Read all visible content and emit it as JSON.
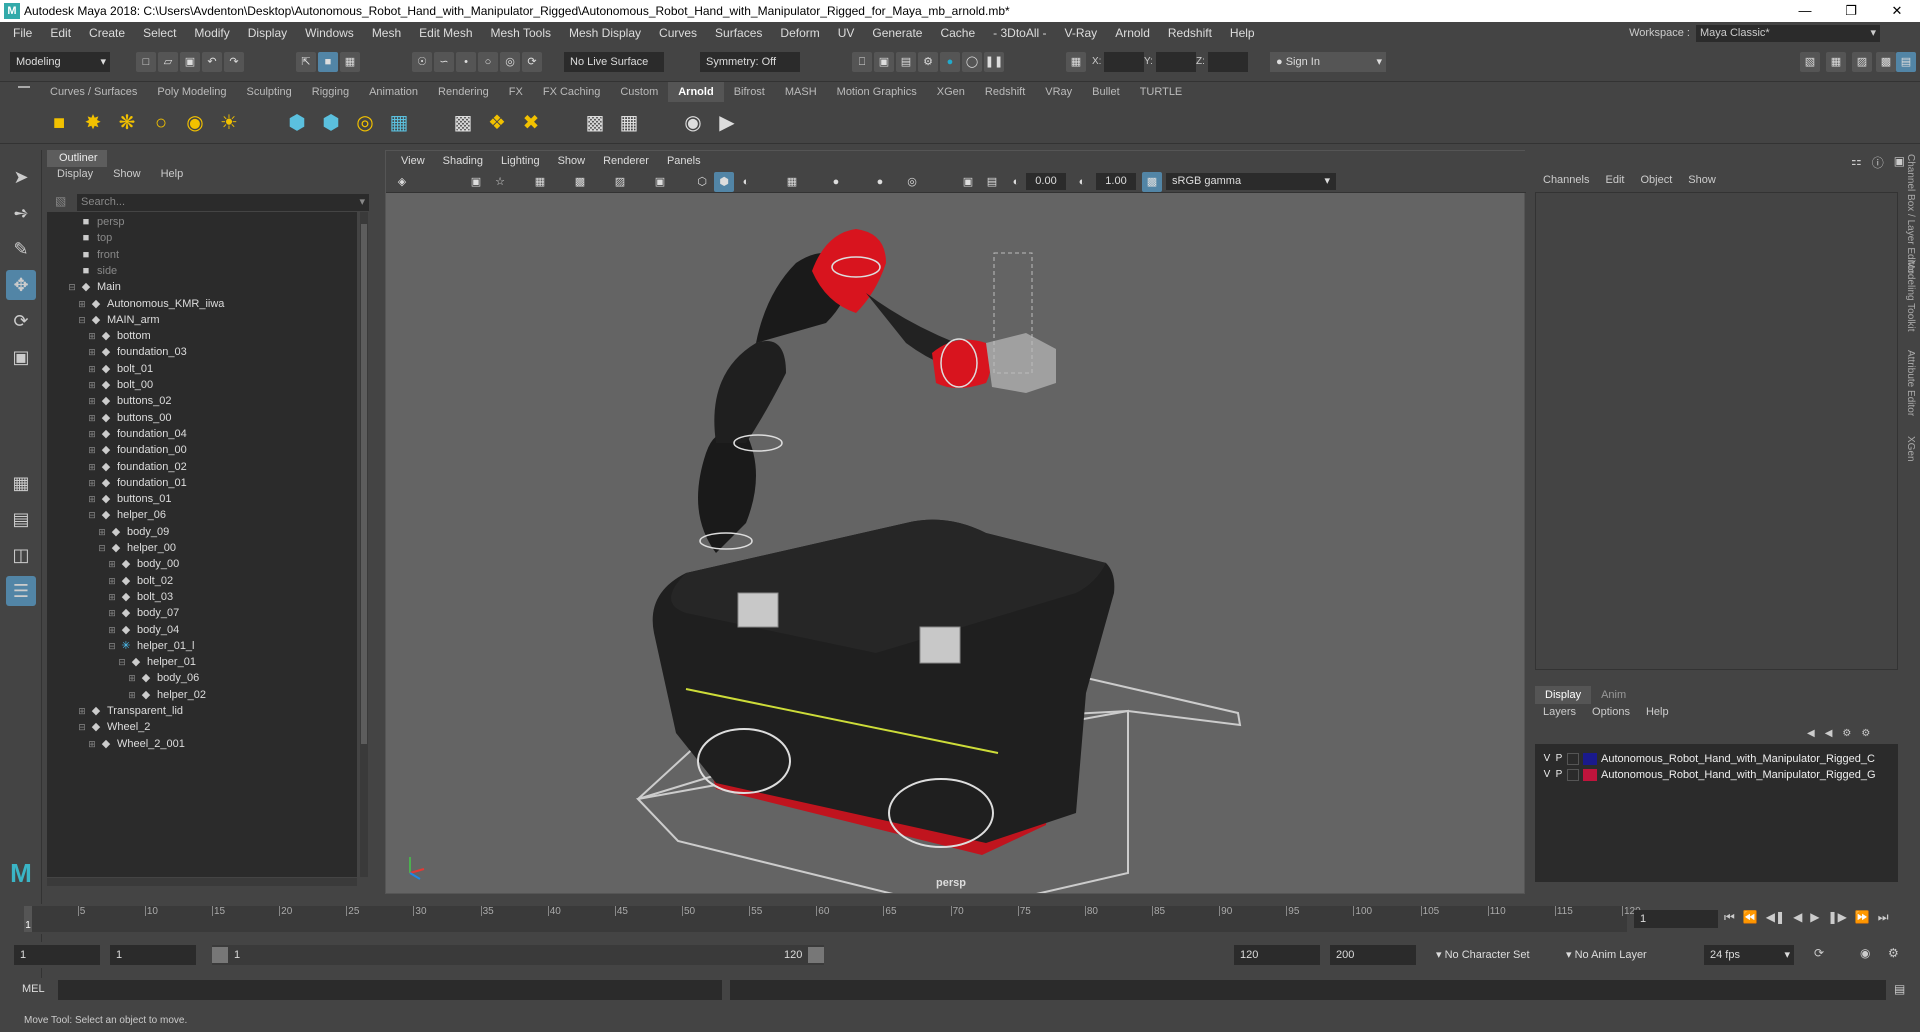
{
  "window": {
    "title": "Autodesk Maya 2018: C:\\Users\\Avdenton\\Desktop\\Autonomous_Robot_Hand_with_Manipulator_Rigged\\Autonomous_Robot_Hand_with_Manipulator_Rigged_for_Maya_mb_arnold.mb*",
    "icon": "M"
  },
  "menubar": [
    "File",
    "Edit",
    "Create",
    "Select",
    "Modify",
    "Display",
    "Windows",
    "Mesh",
    "Edit Mesh",
    "Mesh Tools",
    "Mesh Display",
    "Curves",
    "Surfaces",
    "Deform",
    "UV",
    "Generate",
    "Cache",
    "- 3DtoAll -",
    "V-Ray",
    "Arnold",
    "Redshift",
    "Help"
  ],
  "workspace": {
    "label": "Workspace :",
    "value": "Maya Classic*"
  },
  "statusline": {
    "mode": "Modeling",
    "live_surface": "No Live Surface",
    "symmetry": "Symmetry: Off",
    "x_label": "X:",
    "y_label": "Y:",
    "z_label": "Z:",
    "sign_in": "Sign In"
  },
  "shelf_tabs": [
    "Curves / Surfaces",
    "Poly Modeling",
    "Sculpting",
    "Rigging",
    "Animation",
    "Rendering",
    "FX",
    "FX Caching",
    "Custom",
    "Arnold",
    "Bifrost",
    "MASH",
    "Motion Graphics",
    "XGen",
    "Redshift",
    "VRay",
    "Bullet",
    "TURTLE"
  ],
  "shelf_active": "Arnold",
  "outliner": {
    "tab": "Outliner",
    "menu": [
      "Display",
      "Show",
      "Help"
    ],
    "search_placeholder": "Search...",
    "items": [
      {
        "label": "persp",
        "depth": 0,
        "kind": "camera"
      },
      {
        "label": "top",
        "depth": 0,
        "kind": "camera"
      },
      {
        "label": "front",
        "depth": 0,
        "kind": "camera"
      },
      {
        "label": "side",
        "depth": 0,
        "kind": "camera"
      },
      {
        "label": "Main",
        "depth": 0,
        "kind": "group",
        "expanded": true
      },
      {
        "label": "Autonomous_KMR_iiwa",
        "depth": 1,
        "kind": "group",
        "expanded": false
      },
      {
        "label": "MAIN_arm",
        "depth": 1,
        "kind": "group",
        "expanded": true
      },
      {
        "label": "bottom",
        "depth": 2,
        "kind": "group",
        "expanded": false
      },
      {
        "label": "foundation_03",
        "depth": 2,
        "kind": "group",
        "expanded": false
      },
      {
        "label": "bolt_01",
        "depth": 2,
        "kind": "group",
        "expanded": false
      },
      {
        "label": "bolt_00",
        "depth": 2,
        "kind": "group",
        "expanded": false
      },
      {
        "label": "buttons_02",
        "depth": 2,
        "kind": "group",
        "expanded": false
      },
      {
        "label": "buttons_00",
        "depth": 2,
        "kind": "group",
        "expanded": false
      },
      {
        "label": "foundation_04",
        "depth": 2,
        "kind": "group",
        "expanded": false
      },
      {
        "label": "foundation_00",
        "depth": 2,
        "kind": "group",
        "expanded": false
      },
      {
        "label": "foundation_02",
        "depth": 2,
        "kind": "group",
        "expanded": false
      },
      {
        "label": "foundation_01",
        "depth": 2,
        "kind": "group",
        "expanded": false
      },
      {
        "label": "buttons_01",
        "depth": 2,
        "kind": "group",
        "expanded": false
      },
      {
        "label": "helper_06",
        "depth": 2,
        "kind": "group",
        "expanded": true
      },
      {
        "label": "body_09",
        "depth": 3,
        "kind": "group",
        "expanded": false
      },
      {
        "label": "helper_00",
        "depth": 3,
        "kind": "group",
        "expanded": true
      },
      {
        "label": "body_00",
        "depth": 4,
        "kind": "group",
        "expanded": false
      },
      {
        "label": "bolt_02",
        "depth": 4,
        "kind": "group",
        "expanded": false
      },
      {
        "label": "bolt_03",
        "depth": 4,
        "kind": "group",
        "expanded": false
      },
      {
        "label": "body_07",
        "depth": 4,
        "kind": "group",
        "expanded": false
      },
      {
        "label": "body_04",
        "depth": 4,
        "kind": "group",
        "expanded": false
      },
      {
        "label": "helper_01_l",
        "depth": 4,
        "kind": "joint",
        "expanded": true
      },
      {
        "label": "helper_01",
        "depth": 5,
        "kind": "group",
        "expanded": true
      },
      {
        "label": "body_06",
        "depth": 6,
        "kind": "group",
        "expanded": false
      },
      {
        "label": "helper_02",
        "depth": 6,
        "kind": "group",
        "expanded": false
      },
      {
        "label": "Transparent_lid",
        "depth": 1,
        "kind": "group",
        "expanded": false
      },
      {
        "label": "Wheel_2",
        "depth": 1,
        "kind": "group",
        "expanded": true
      },
      {
        "label": "Wheel_2_001",
        "depth": 2,
        "kind": "group",
        "expanded": false
      }
    ]
  },
  "viewport": {
    "menu": [
      "View",
      "Shading",
      "Lighting",
      "Show",
      "Renderer",
      "Panels"
    ],
    "field_exposure": "0.00",
    "field_gamma": "1.00",
    "color_space": "sRGB gamma",
    "camera_label": "persp"
  },
  "channel_box": {
    "menu": [
      "Channels",
      "Edit",
      "Object",
      "Show"
    ]
  },
  "layer_editor": {
    "tabs": [
      "Display",
      "Anim"
    ],
    "active_tab": "Display",
    "menu": [
      "Layers",
      "Options",
      "Help"
    ],
    "layers": [
      {
        "v": "V",
        "p": "P",
        "name": "Autonomous_Robot_Hand_with_Manipulator_Rigged_C",
        "color": "#1a1a8c"
      },
      {
        "v": "V",
        "p": "P",
        "name": "Autonomous_Robot_Hand_with_Manipulator_Rigged_G",
        "color": "#c0143c"
      }
    ]
  },
  "side_tabs": [
    "Channel Box / Layer Editor",
    "Modeling Toolkit",
    "Attribute Editor",
    "XGen"
  ],
  "timeline": {
    "ticks": [
      1,
      5,
      10,
      15,
      20,
      25,
      30,
      35,
      40,
      45,
      50,
      55,
      60,
      65,
      70,
      75,
      80,
      85,
      90,
      95,
      100,
      105,
      110,
      115,
      120
    ],
    "current_frame": "1",
    "current_field": "1"
  },
  "range": {
    "start": "1",
    "anim_start": "1",
    "slider_start": "1",
    "slider_end": "120",
    "end": "120",
    "anim_end": "200",
    "character_set": "No Character Set",
    "anim_layer": "No Anim Layer",
    "fps": "24 fps"
  },
  "cmdline": {
    "label": "MEL"
  },
  "helpline": "Move Tool: Select an object to move.",
  "colors": {
    "accent": "#5285a6",
    "panel": "#444444",
    "field": "#2b2b2b",
    "viewport": "#646464"
  }
}
